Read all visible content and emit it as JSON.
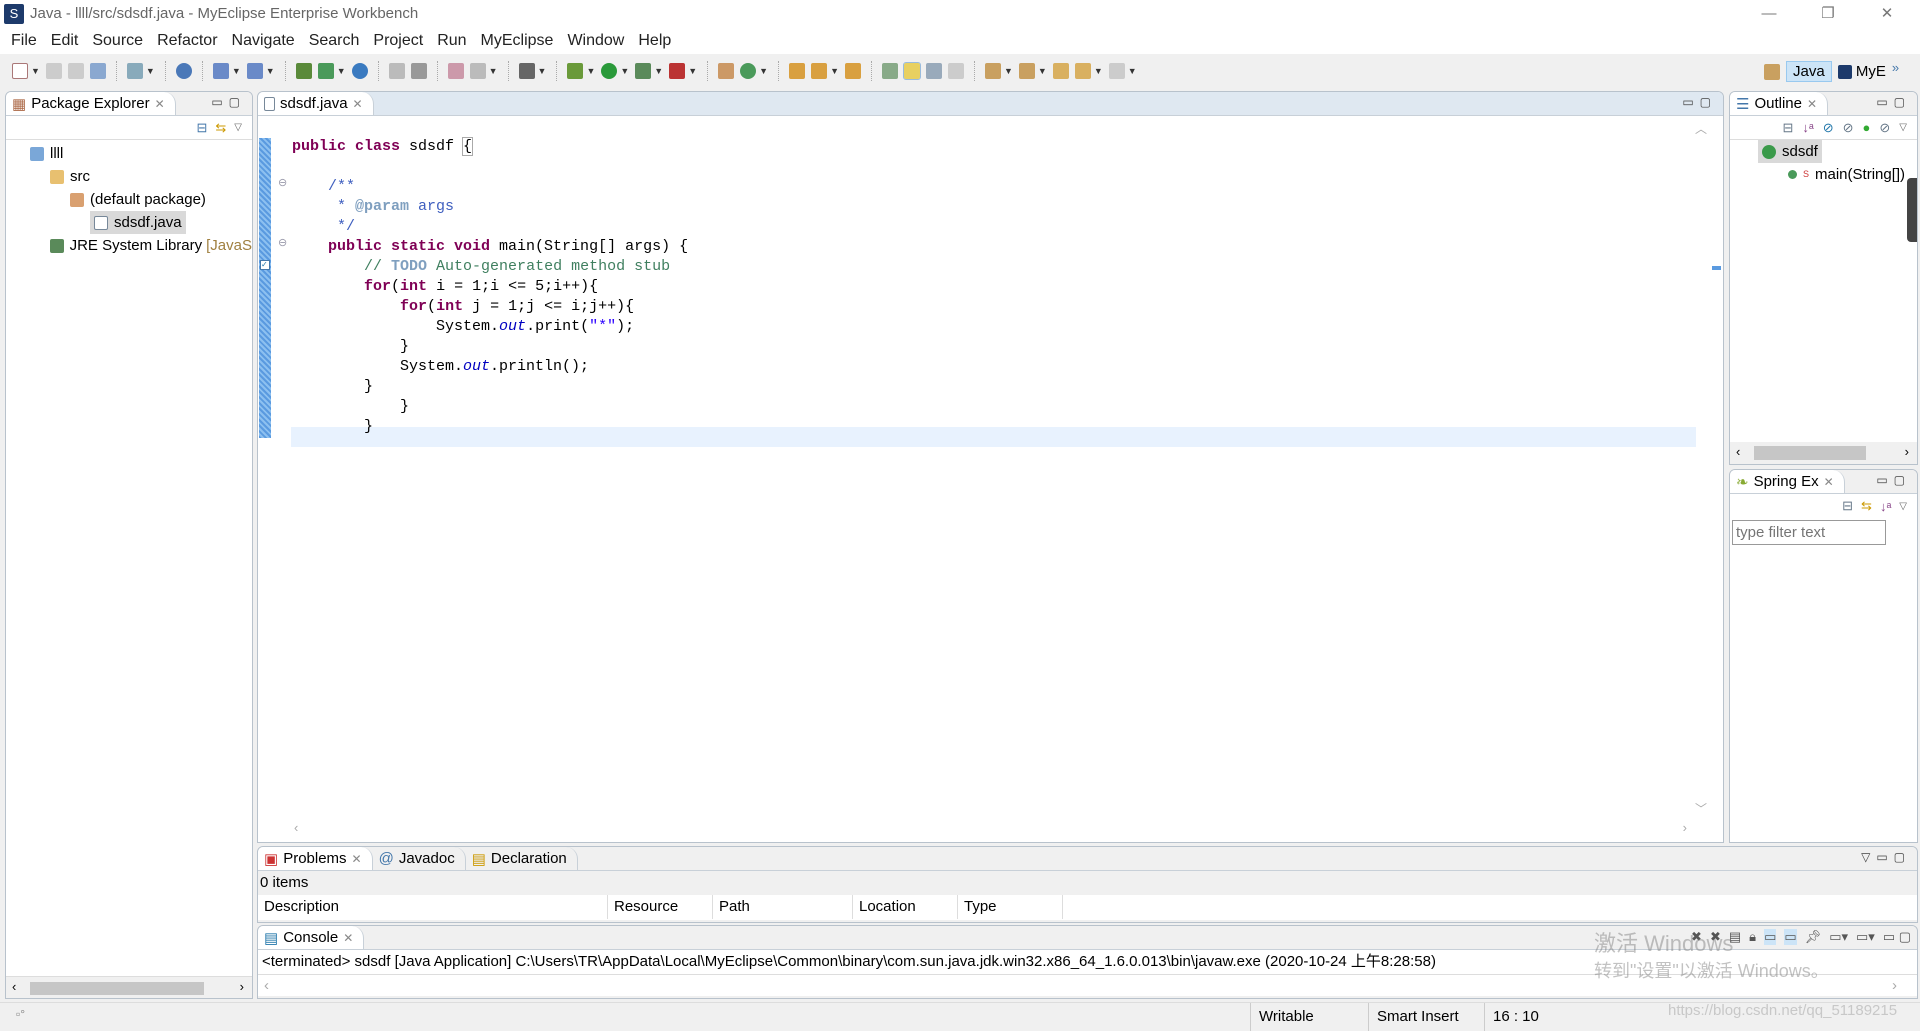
{
  "window": {
    "title": "Java - llll/src/sdsdf.java - MyEclipse Enterprise Workbench",
    "minimize": "—",
    "restore": "❐",
    "close": "✕"
  },
  "menu": [
    "File",
    "Edit",
    "Source",
    "Refactor",
    "Navigate",
    "Search",
    "Project",
    "Run",
    "MyEclipse",
    "Window",
    "Help"
  ],
  "perspectives": {
    "java": "Java",
    "myeclipse": "MyE",
    "more": "»"
  },
  "package_explorer": {
    "title": "Package Explorer",
    "tree": [
      {
        "label": "llll",
        "icon": "project-icon"
      },
      {
        "label": "src",
        "icon": "source-folder-icon"
      },
      {
        "label": "(default package)",
        "icon": "package-icon"
      },
      {
        "label": "sdsdf.java",
        "icon": "java-file-icon",
        "selected": true
      },
      {
        "label": "JRE System Library",
        "suffix": "[JavaS",
        "icon": "library-icon"
      }
    ]
  },
  "editor": {
    "tab": "sdsdf.java",
    "current_line": 16
  },
  "outline": {
    "title": "Outline",
    "items": [
      {
        "label": "sdsdf",
        "icon": "class-icon"
      },
      {
        "label": "main(String[])",
        "icon": "method-icon",
        "modifier": "S"
      }
    ]
  },
  "spring": {
    "title": "Spring Ex",
    "filter_placeholder": "type filter text"
  },
  "problems": {
    "tabs": [
      "Problems",
      "Javadoc",
      "Declaration"
    ],
    "count": "0 items",
    "columns": [
      "Description",
      "Resource",
      "Path",
      "Location",
      "Type"
    ]
  },
  "console": {
    "title": "Console",
    "text": "<terminated> sdsdf [Java Application] C:\\Users\\TR\\AppData\\Local\\MyEclipse\\Common\\binary\\com.sun.java.jdk.win32.x86_64_1.6.0.013\\bin\\javaw.exe (2020-10-24 上午8:28:58)"
  },
  "status": {
    "writable": "Writable",
    "insert": "Smart Insert",
    "position": "16 : 10"
  },
  "watermark": {
    "line1": "激活 Windows",
    "line2": "转到\"设置\"以激活 Windows。",
    "url": "https://blog.csdn.net/qq_51189215"
  }
}
